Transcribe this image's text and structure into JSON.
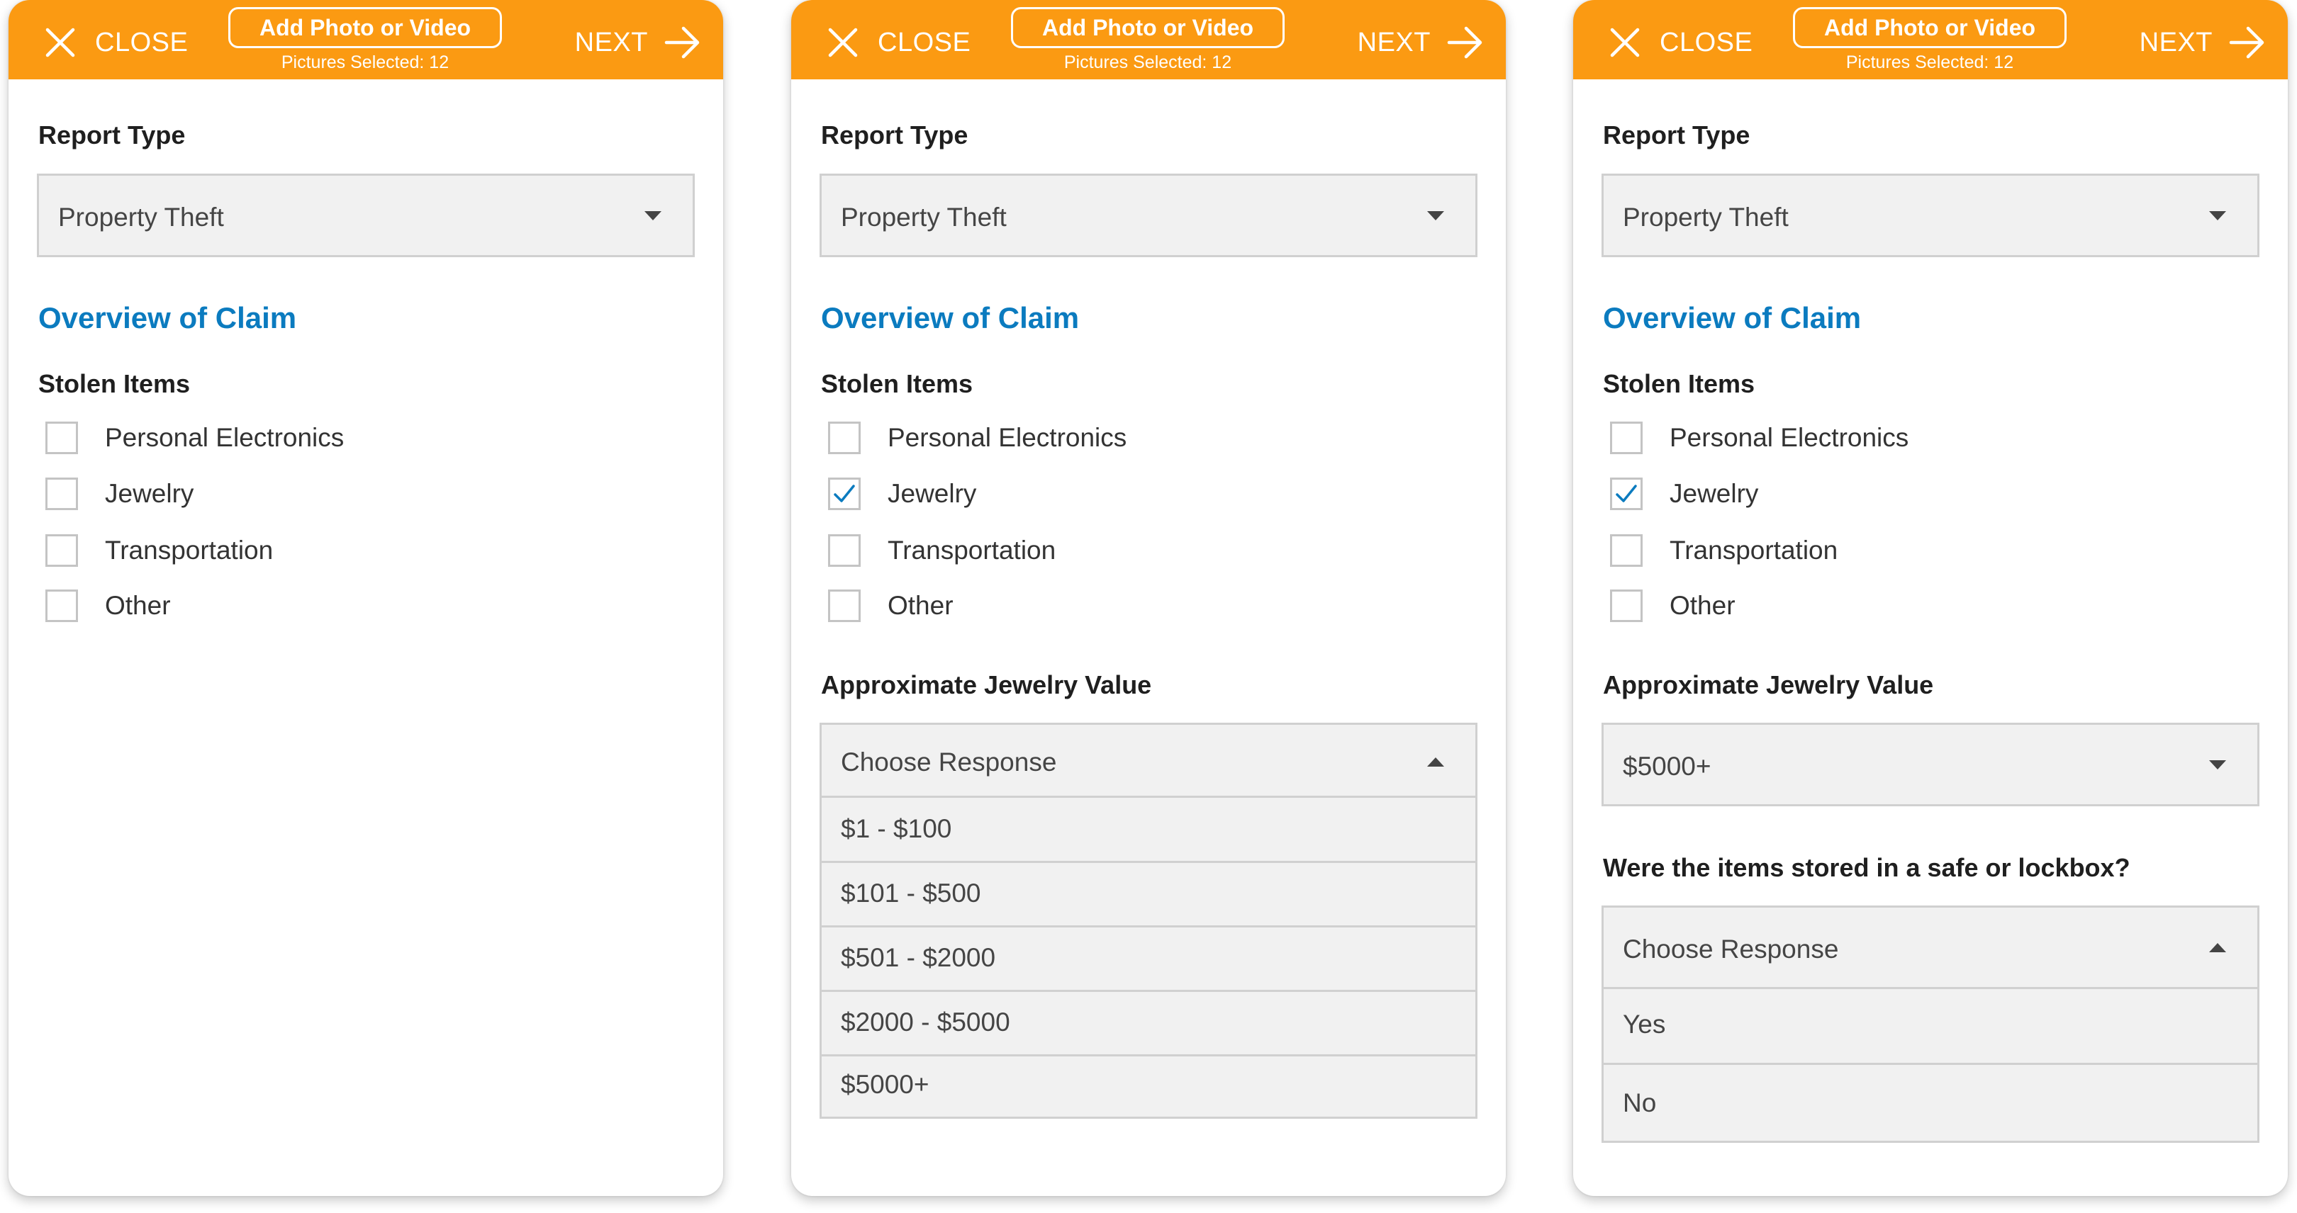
{
  "header": {
    "close_label": "CLOSE",
    "next_label": "NEXT",
    "add_media_label": "Add Photo or Video",
    "pictures_selected": "Pictures Selected: 12"
  },
  "form": {
    "report_type_label": "Report Type",
    "report_type_value": "Property Theft",
    "overview_title": "Overview of Claim",
    "stolen_items_label": "Stolen Items",
    "items": [
      "Personal Electronics",
      "Jewelry",
      "Transportation",
      "Other"
    ],
    "jewelry_value_label": "Approximate Jewelry Value",
    "choose_response": "Choose Response",
    "jewelry_options": [
      "$1 - $100",
      "$101 - $500",
      "$501 - $2000",
      "$2000 - $5000",
      "$5000+"
    ],
    "jewelry_selected": "$5000+",
    "safe_question": "Were the items stored in a safe or lockbox?",
    "safe_options": [
      "Yes",
      "No"
    ]
  },
  "screens": [
    {
      "checked": [
        false,
        false,
        false,
        false
      ]
    },
    {
      "checked": [
        false,
        true,
        false,
        false
      ],
      "jewelry_dropdown": "open"
    },
    {
      "checked": [
        false,
        true,
        false,
        false
      ],
      "jewelry_dropdown": "closed",
      "safe_dropdown": "open"
    }
  ],
  "colors": {
    "header_bg": "#fb9a12",
    "section_title": "#0b7bbf",
    "checkmark": "#0b7bbf",
    "field_bg": "#f1f1f1"
  }
}
